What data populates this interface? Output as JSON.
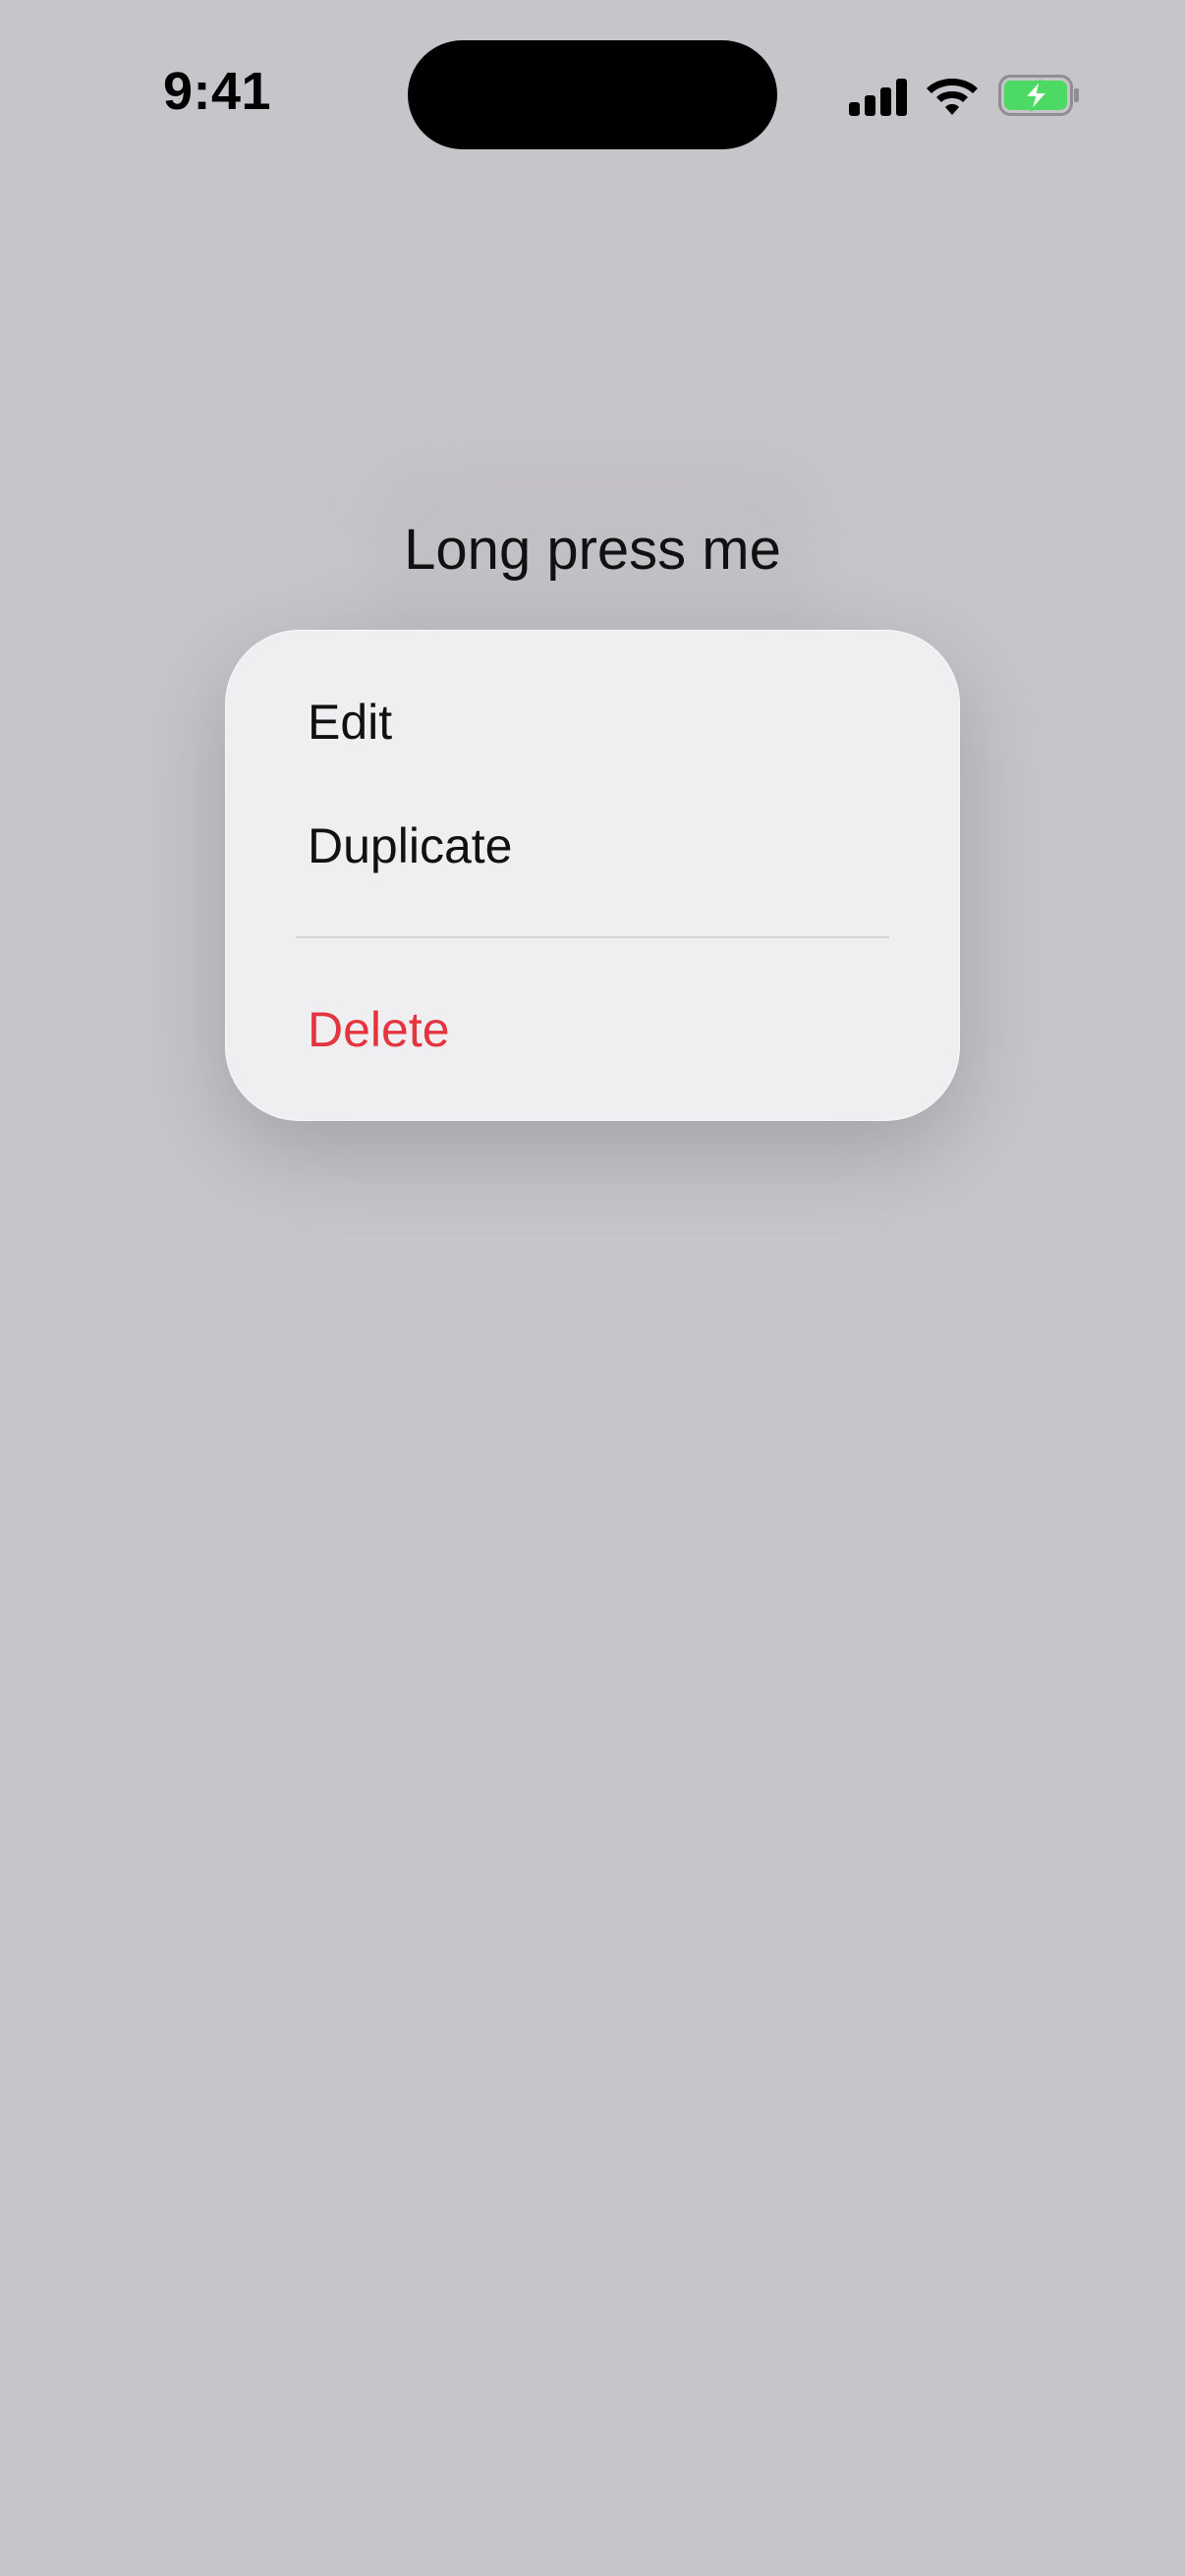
{
  "status_bar": {
    "time": "9:41",
    "icons": [
      "cellular-signal-icon",
      "wifi-icon",
      "battery-charging-icon"
    ],
    "battery_color": "#4cd964"
  },
  "content": {
    "label": "Long press me"
  },
  "context_menu": {
    "items": [
      {
        "label": "Edit"
      },
      {
        "label": "Duplicate"
      },
      {
        "label": "Delete",
        "destructive": true,
        "color": "#e5343d"
      }
    ]
  }
}
